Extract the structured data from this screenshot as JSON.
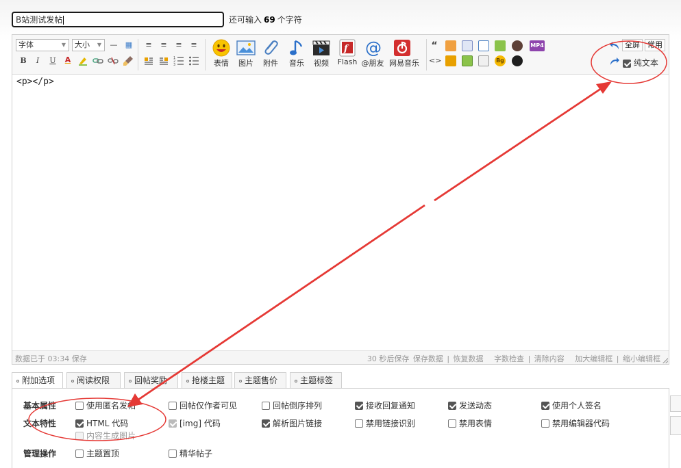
{
  "title_field": {
    "value": "B站测试发帖"
  },
  "counter": {
    "prefix": "还可输入",
    "count": "69",
    "suffix": "个字符"
  },
  "toolbar": {
    "font_select": "字体",
    "size_select": "大小",
    "row1_small_icons": [
      "—",
      "▦"
    ],
    "align_icons": [
      "≡",
      "≡",
      "≡",
      "≡"
    ],
    "row2_format": [
      "B",
      "I",
      "U",
      "A"
    ],
    "big_buttons": [
      {
        "label": "表情",
        "icon": "smiley-icon"
      },
      {
        "label": "图片",
        "icon": "image-icon"
      },
      {
        "label": "附件",
        "icon": "paperclip-icon"
      },
      {
        "label": "音乐",
        "icon": "music-note-icon"
      },
      {
        "label": "视频",
        "icon": "video-clapper-icon"
      },
      {
        "label": "Flash",
        "icon": "flash-icon"
      },
      {
        "label": "@朋友",
        "icon": "at-icon"
      },
      {
        "label": "网易音乐",
        "icon": "netease-music-icon"
      }
    ],
    "quote_glyph": "“",
    "code_glyph": "<>",
    "mp4_label": "MP4",
    "bg_label": "Bg",
    "fullscreen_label": "全屏",
    "common_label": "常用",
    "plaintext_label": "纯文本",
    "plaintext_checked": true
  },
  "editor_content": "<p></p>",
  "statusbar": {
    "saved_text": "数据已于 03:34 保存",
    "autosave": "30 秒后保存",
    "save_data": "保存数据",
    "restore_data": "恢复数据",
    "word_check": "字数检查",
    "clear_content": "清除内容",
    "enlarge": "加大编辑框",
    "shrink": "缩小编辑框",
    "divider": "|"
  },
  "tabs": [
    "附加选项",
    "阅读权限",
    "回帖奖励",
    "抢楼主题",
    "主题售价",
    "主题标签"
  ],
  "options": {
    "basic_label": "基本属性",
    "text_label": "文本特性",
    "admin_label": "管理操作",
    "basic": [
      {
        "label": "使用匿名发帖",
        "checked": false
      },
      {
        "label": "回帖仅作者可见",
        "checked": false
      },
      {
        "label": "回帖倒序排列",
        "checked": false
      },
      {
        "label": "接收回复通知",
        "checked": true
      },
      {
        "label": "发送动态",
        "checked": true
      },
      {
        "label": "使用个人签名",
        "checked": true
      }
    ],
    "text": [
      {
        "label": "HTML 代码",
        "checked": true
      },
      {
        "label": "[img] 代码",
        "checked": true,
        "disabled": true
      },
      {
        "label": "解析图片链接",
        "checked": true
      },
      {
        "label": "禁用链接识别",
        "checked": false
      },
      {
        "label": "禁用表情",
        "checked": false
      },
      {
        "label": "禁用编辑器代码",
        "checked": false
      }
    ],
    "image_gen": {
      "label": "内容生成图片",
      "checked": false,
      "disabled": true
    },
    "admin": [
      {
        "label": "主题置顶",
        "checked": false
      },
      {
        "label": "精华帖子",
        "checked": false
      }
    ]
  },
  "colors": {
    "annotation_red": "#e53935",
    "accent_orange": "#e67e22"
  }
}
